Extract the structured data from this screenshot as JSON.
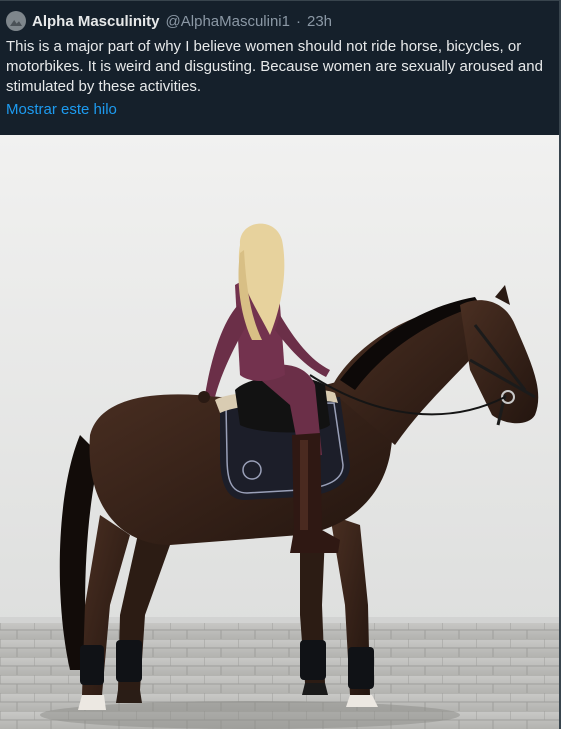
{
  "tweet": {
    "display_name": "Alpha Masculinity",
    "handle": "@AlphaMasculini1",
    "separator": "·",
    "time": "23h",
    "text": "This is a major part of why I believe women should not ride horse, bicycles, or motorbikes. It is weird and disgusting. Because women are sexually aroused and stimulated by these activities.",
    "show_thread": "Mostrar este hilo"
  },
  "media": {
    "icon": "photo-of-woman-on-horse"
  },
  "colors": {
    "background": "#15202b",
    "text": "#e7e9ea",
    "muted": "#8b98a5",
    "link": "#1d9bf0"
  }
}
